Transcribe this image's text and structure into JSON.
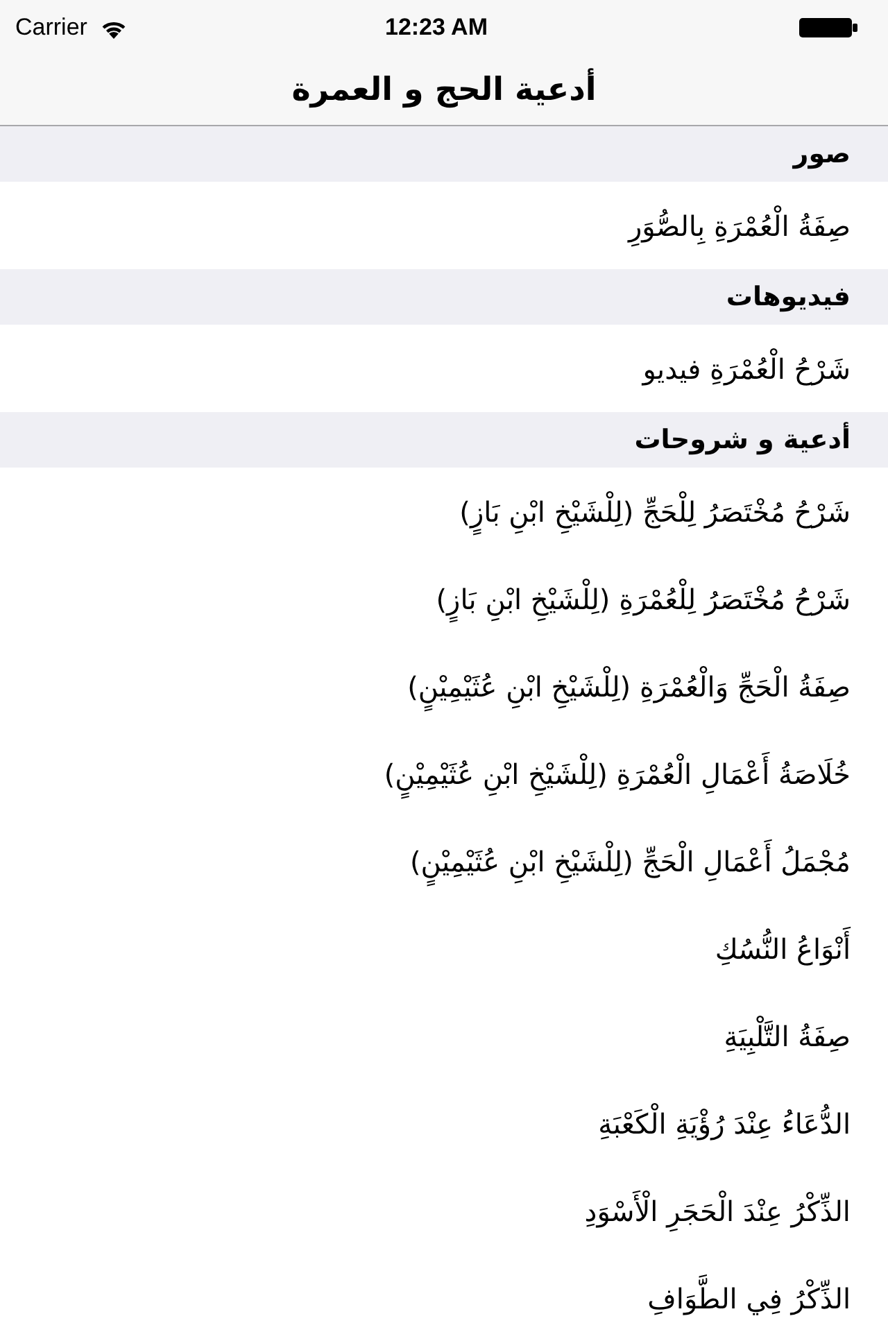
{
  "status_bar": {
    "carrier": "Carrier",
    "time": "12:23 AM"
  },
  "nav_bar": {
    "title": "أدعية الحج و العمرة"
  },
  "sections": [
    {
      "header": "صور",
      "items": [
        {
          "label": "صِفَةُ الْعُمْرَةِ بِالصُّوَرِ"
        }
      ]
    },
    {
      "header": "فيديوهات",
      "items": [
        {
          "label": "شَرْحُ الْعُمْرَةِ فيديو"
        }
      ]
    },
    {
      "header": "أدعية و شروحات",
      "items": [
        {
          "label": "شَرْحُ مُخْتَصَرُ لِلْحَجِّ (لِلْشَيْخِ ابْنِ بَازٍ)"
        },
        {
          "label": "شَرْحُ مُخْتَصَرُ لِلْعُمْرَةِ (لِلْشَيْخِ ابْنِ بَازٍ)"
        },
        {
          "label": "صِفَةُ الْحَجِّ وَالْعُمْرَةِ (لِلْشَيْخِ ابْنِ عُثَيْمِيْنٍ)"
        },
        {
          "label": "خُلَاصَةُ أَعْمَالِ الْعُمْرَةِ (لِلْشَيْخِ ابْنِ عُثَيْمِيْنٍ)"
        },
        {
          "label": "مُجْمَلُ أَعْمَالِ الْحَجِّ (لِلْشَيْخِ ابْنِ عُثَيْمِيْنٍ)"
        },
        {
          "label": "أَنْوَاعُ النُّسُكِ"
        },
        {
          "label": "صِفَةُ التَّلْبِيَةِ"
        },
        {
          "label": "الدُّعَاءُ عِنْدَ رُؤْيَةِ الْكَعْبَةِ"
        },
        {
          "label": "الذِّكْرُ عِنْدَ الْحَجَرِ الْأَسْوَدِ"
        },
        {
          "label": "الذِّكْرُ فِي الطَّوَافِ"
        }
      ]
    }
  ]
}
